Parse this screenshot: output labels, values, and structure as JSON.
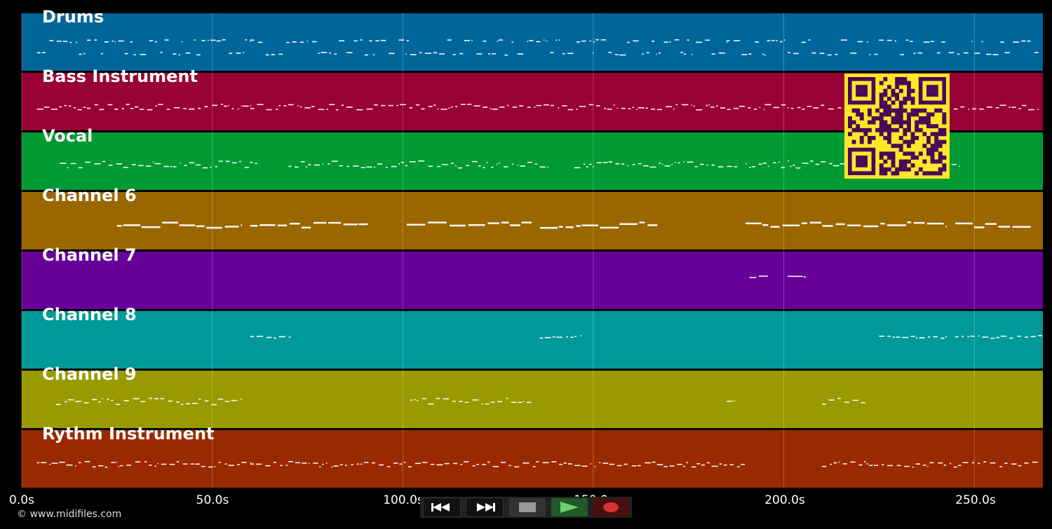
{
  "tracks": [
    {
      "name": "Drums",
      "color": "#006699"
    },
    {
      "name": "Bass Instrument",
      "color": "#990033"
    },
    {
      "name": "Vocal",
      "color": "#009933"
    },
    {
      "name": "Channel 6",
      "color": "#996600"
    },
    {
      "name": "Channel 7",
      "color": "#660099"
    },
    {
      "name": "Channel 8",
      "color": "#009999"
    },
    {
      "name": "Channel 9",
      "color": "#999900"
    },
    {
      "name": "Rythm Instrument",
      "color": "#992900"
    }
  ],
  "axis": {
    "ticks": [
      "0.0s",
      "50.0s",
      "100.0s",
      "150.0s",
      "200.0s",
      "250.0s"
    ],
    "unit": "s",
    "range": [
      0,
      268
    ]
  },
  "transport": {
    "buttons": [
      {
        "name": "rewind-button",
        "icon": "rewind-icon"
      },
      {
        "name": "fast-forward-button",
        "icon": "fast-forward-icon"
      },
      {
        "name": "stop-button",
        "icon": "stop-icon"
      },
      {
        "name": "play-button",
        "icon": "play-icon"
      },
      {
        "name": "record-button",
        "icon": "record-icon"
      }
    ]
  },
  "footer": {
    "copyright": "© www.midifiles.com"
  },
  "overlay": {
    "qr_code": "qr-code-icon",
    "qr_color": "#ffe629",
    "qr_dark": "#4a0a55"
  }
}
